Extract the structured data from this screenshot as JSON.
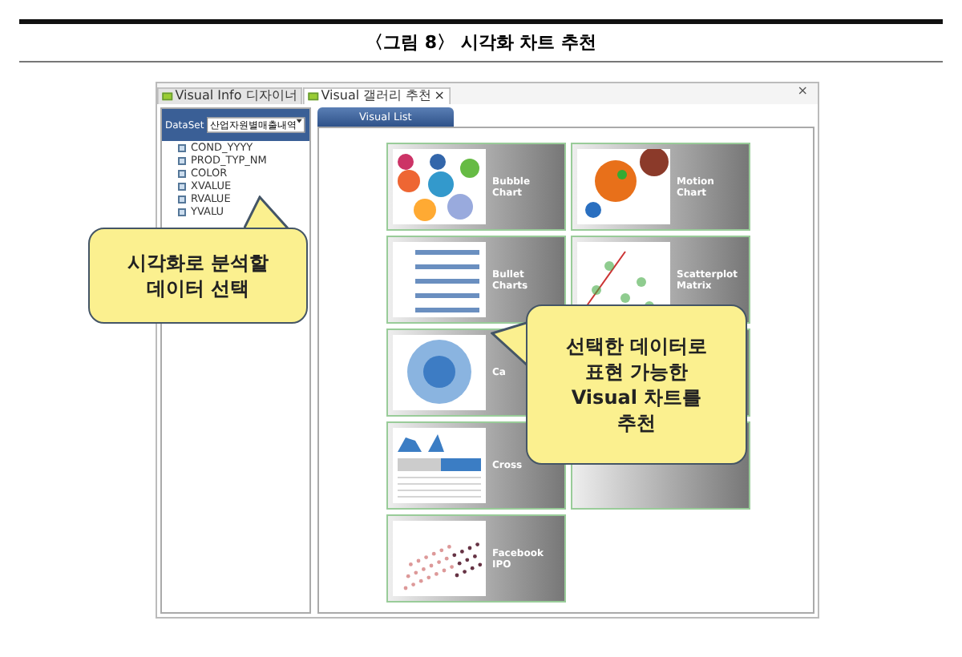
{
  "figure": {
    "caption": "〈그림 8〉 시각화 차트 추천"
  },
  "window": {
    "tabs": [
      {
        "label": "Visual Info 디자이너",
        "selected": false
      },
      {
        "label": "Visual 갤러리 추천",
        "selected": true,
        "closable": "×"
      }
    ],
    "controls": "×"
  },
  "dataset": {
    "label": "DataSet",
    "value": "산업자원별매출내역"
  },
  "fields": [
    "COND_YYYY",
    "PROD_TYP_NM",
    "COLOR",
    "XVALUE",
    "RVALUE",
    "YVALU"
  ],
  "visual_list": {
    "tab": "Visual List",
    "cards": [
      {
        "kind": "bubble",
        "label": "Bubble Chart"
      },
      {
        "kind": "motion",
        "label": "Motion Chart"
      },
      {
        "kind": "bullet",
        "label": "Bullet Charts"
      },
      {
        "kind": "scatter",
        "label": "Scatterplot Matrix"
      },
      {
        "kind": "circle",
        "label": "Ca"
      },
      {
        "kind": "blank"
      },
      {
        "kind": "cross",
        "label": "Cross"
      },
      {
        "kind": "blank"
      },
      {
        "kind": "points",
        "label": "Facebook IPO"
      }
    ]
  },
  "callouts": [
    {
      "text": "시각화로 분석할\n데이터 선택"
    },
    {
      "text": "선택한 데이터로\n표현 가능한\nVisual 차트를\n추천"
    }
  ]
}
